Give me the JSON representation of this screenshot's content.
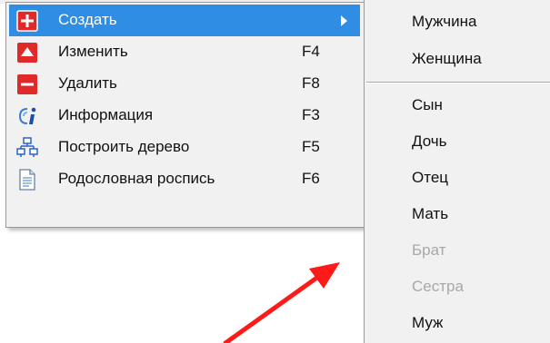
{
  "context_menu": {
    "items": [
      {
        "label": "Создать",
        "shortcut": "",
        "icon": "plus-icon",
        "has_submenu": true,
        "selected": true
      },
      {
        "label": "Изменить",
        "shortcut": "F4",
        "icon": "edit-icon"
      },
      {
        "label": "Удалить",
        "shortcut": "F8",
        "icon": "minus-icon"
      },
      {
        "label": "Информация",
        "shortcut": "F3",
        "icon": "info-icon"
      },
      {
        "label": "Построить дерево",
        "shortcut": "F5",
        "icon": "tree-icon"
      },
      {
        "label": "Родословная роспись",
        "shortcut": "F6",
        "icon": "document-icon"
      }
    ]
  },
  "submenu": {
    "items": [
      {
        "label": "Мужчина",
        "enabled": true
      },
      {
        "label": "Женщина",
        "enabled": true
      },
      {
        "label": "Сын",
        "enabled": true
      },
      {
        "label": "Дочь",
        "enabled": true
      },
      {
        "label": "Отец",
        "enabled": true
      },
      {
        "label": "Мать",
        "enabled": true
      },
      {
        "label": "Брат",
        "enabled": false
      },
      {
        "label": "Сестра",
        "enabled": false
      },
      {
        "label": "Муж",
        "enabled": true
      }
    ]
  },
  "colors": {
    "selection": "#2f8ee4",
    "menu_background": "#f1f1f1",
    "disabled_text": "#a8a8a8",
    "annotation_arrow": "#ff1a1a"
  }
}
